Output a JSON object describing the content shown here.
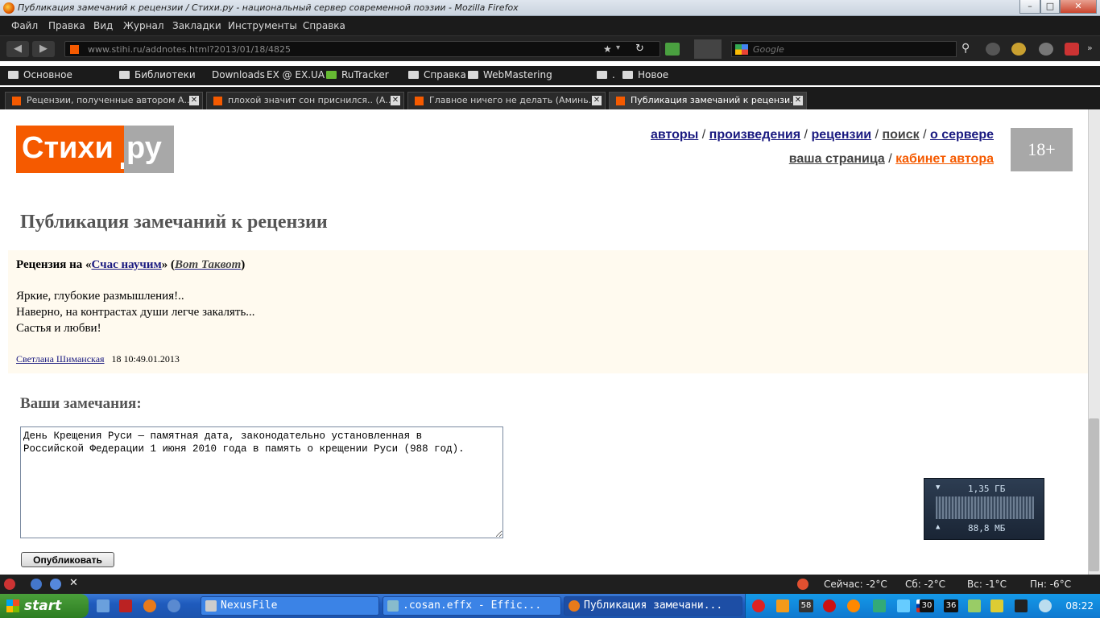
{
  "window": {
    "title": "Публикация замечаний к рецензии / Стихи.ру - национальный сервер современной поэзии - Mozilla Firefox"
  },
  "menu": [
    "Файл",
    "Правка",
    "Вид",
    "Журнал",
    "Закладки",
    "Инструменты",
    "Справка"
  ],
  "navbar": {
    "url_domain": "www.stihi.ru",
    "url_path": "/addnotes.html?2013/01/18/4825",
    "search_placeholder": "Google"
  },
  "bookmarks": [
    "Основное",
    "Библиотеки",
    "Downloads",
    "EX @ EX.UA",
    "RuTracker",
    "Справка",
    "WebMastering",
    ".",
    "Новое"
  ],
  "tabs": [
    {
      "label": "Рецензии, полученные автором А..."
    },
    {
      "label": "плохой значит сон приснился.. (А..."
    },
    {
      "label": "Главное ничего не делать (Аминь..."
    },
    {
      "label": "Публикация замечаний к рецензи..."
    }
  ],
  "site": {
    "logo_main": "Стихи",
    "logo_suffix": "ру",
    "nav_top": [
      "авторы",
      "произведения",
      "рецензии",
      "поиск",
      "о сервере"
    ],
    "nav_bottom": [
      "ваша страница",
      "кабинет автора"
    ],
    "age": "18+"
  },
  "page": {
    "title": "Публикация замечаний к рецензии",
    "review_prefix": "Рецензия на «",
    "review_work": "Счас научим",
    "review_mid": "» (",
    "review_author": "Вот Таквот",
    "review_suffix": ")",
    "review_lines": [
      "Яркие, глубокие размышления!..",
      "Наверно, на контрастах души легче закалять...",
      "Састья и любви!"
    ],
    "reviewer": "Светлана Шиманская",
    "review_date": "18 10:49.01.2013",
    "notes_heading": "Ваши замечания:",
    "notes_text": "День Крещения Руси — памятная дата, законодательно установленная в\nРоссийской Федерации 1 июня 2010 года в память о крещении Руси (988 год).",
    "publish_label": "Опубликовать"
  },
  "netwidget": {
    "down": "1,35 ГБ",
    "up": "88,8 МБ"
  },
  "statusbar": {
    "weather": [
      "Сейчас: -2°C",
      "Сб: -2°C",
      "Вс: -1°C",
      "Пн: -6°C"
    ]
  },
  "taskbar": {
    "start": "start",
    "items": [
      {
        "label": "NexusFile"
      },
      {
        "label": ".cosan.effx - Effic..."
      },
      {
        "label": "Публикация замечани..."
      }
    ],
    "tray_nums": [
      "58",
      "30",
      "36"
    ],
    "clock": "08:22"
  }
}
